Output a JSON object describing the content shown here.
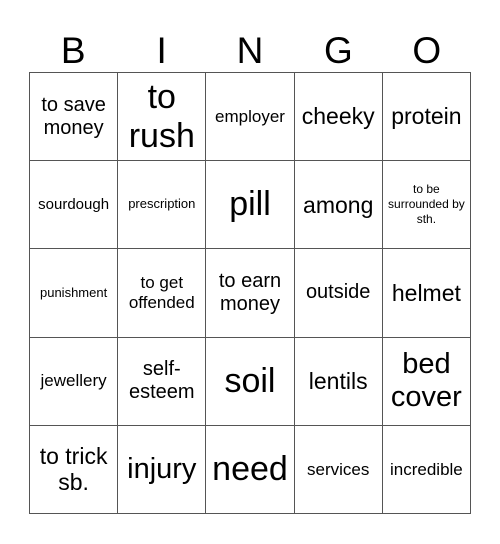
{
  "header": {
    "letters": [
      "B",
      "I",
      "N",
      "G",
      "O"
    ]
  },
  "grid": {
    "rows": [
      [
        "to save money",
        "to rush",
        "employer",
        "cheeky",
        "protein"
      ],
      [
        "sourdough",
        "prescription",
        "pill",
        "among",
        "to be surrounded by sth."
      ],
      [
        "punishment",
        "to get offended",
        "to earn money",
        "outside",
        "helmet"
      ],
      [
        "jewellery",
        "self-esteem",
        "soil",
        "lentils",
        "bed cover"
      ],
      [
        "to trick sb.",
        "injury",
        "need",
        "services",
        "incredible"
      ]
    ]
  }
}
